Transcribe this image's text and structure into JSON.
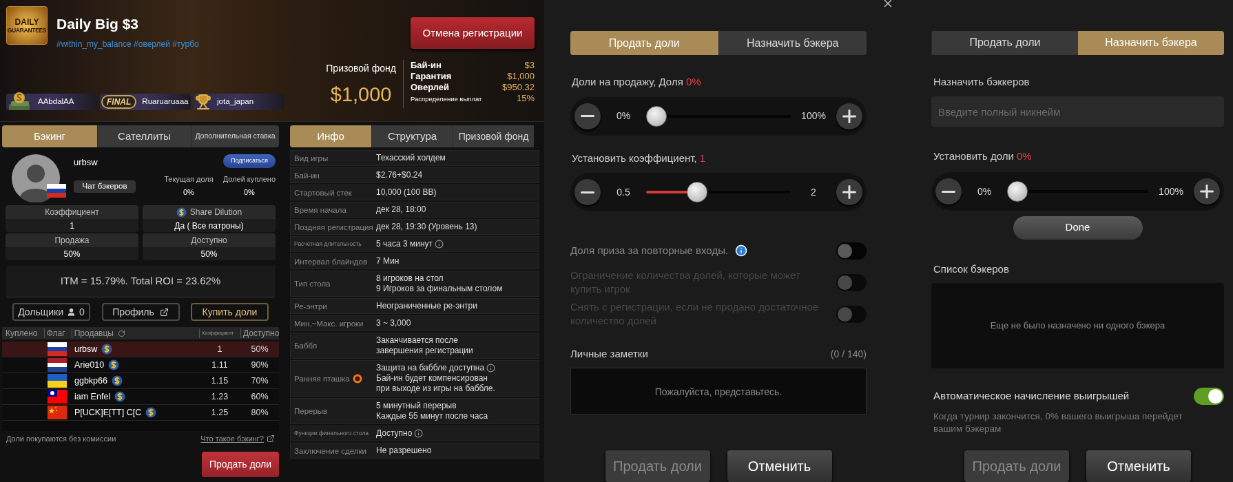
{
  "tournament": {
    "logo_text": [
      "DAILY",
      "GUARANTEES"
    ],
    "title": "Daily Big $3",
    "tags": "#within_my_balance #оверлей #турбо",
    "cancel_button": "Отмена регистрации",
    "prize_label": "Призовой фонд",
    "prize_amount": "$1,000",
    "details": [
      {
        "label": "Бай-ин",
        "value": "$3",
        "kind": "main"
      },
      {
        "label": "Гарантия",
        "value": "$1,000",
        "kind": "main"
      },
      {
        "label": "Оверлей",
        "value": "$950.32",
        "kind": "main"
      },
      {
        "label": "Распределение выплат",
        "value": "15%",
        "kind": "minor"
      }
    ],
    "winners": [
      {
        "kind": "cash",
        "name": "AAbdalAA"
      },
      {
        "kind": "final",
        "badge": "FINAL",
        "name": "Ruaruaruaaa"
      },
      {
        "kind": "trophy",
        "name": "jota_japan"
      }
    ]
  },
  "backing": {
    "tabs": [
      {
        "label": "Бэкинг",
        "selected": true
      },
      {
        "label": "Сателлиты",
        "selected": false
      },
      {
        "label": "Дополнительная ставка",
        "selected": false
      }
    ],
    "player": {
      "name": "urbsw",
      "flag": {
        "kind": "ru"
      },
      "subscribe": "Подписаться",
      "chat": "Чат бэкеров",
      "stats": [
        {
          "label": "Текущая доля",
          "value": "0%"
        },
        {
          "label": "Долей куплено",
          "value": "0%"
        }
      ]
    },
    "terms": [
      {
        "label": "Коэффициент",
        "value": "1",
        "icon": false
      },
      {
        "label": "Share Dilution",
        "value": "Да ( Все патроны)",
        "icon": true
      },
      {
        "label": "Продажа",
        "value": "50%",
        "icon": false
      },
      {
        "label": "Доступно",
        "value": "50%",
        "icon": false
      }
    ],
    "roi": "ITM = 15.79%. Total ROI = 23.62%",
    "actions": [
      {
        "kind": "holders",
        "label": "Дольщики",
        "count": "0"
      },
      {
        "kind": "profile",
        "label": "Профиль"
      },
      {
        "kind": "buy",
        "label": "Купить доли"
      }
    ],
    "columns": [
      {
        "label": "Куплено",
        "kind": "plain"
      },
      {
        "label": "Флаг",
        "kind": "plain"
      },
      {
        "label": "Продавцы",
        "kind": "refresh"
      },
      {
        "label": "Коэффициент",
        "kind": "compact"
      },
      {
        "label": "Доступно",
        "kind": "plain"
      }
    ],
    "rows": [
      {
        "flag": {
          "kind": "ru"
        },
        "seller": "urbsw",
        "rate": "1",
        "available": "50%",
        "selected": true
      },
      {
        "flag": {
          "kind": "nl"
        },
        "seller": "Arie010",
        "rate": "1.11",
        "available": "90%",
        "selected": false
      },
      {
        "flag": {
          "kind": "ua"
        },
        "seller": "ggbkp66",
        "rate": "1.15",
        "available": "70%",
        "selected": false
      },
      {
        "flag": {
          "kind": "tw"
        },
        "seller": "iam Enfel",
        "rate": "1.23",
        "available": "60%",
        "selected": false
      },
      {
        "flag": {
          "kind": "cn"
        },
        "seller": "P[UCK]E[TT] C[C",
        "rate": "1.25",
        "available": "80%",
        "selected": false
      }
    ],
    "footer_note": "Доли покупаются без комиссии",
    "help_link": "Что такое бэкинг?",
    "sell_button": "Продать доли"
  },
  "info": {
    "tabs": [
      {
        "label": "Инфо",
        "selected": true
      },
      {
        "label": "Структура",
        "selected": false
      },
      {
        "label": "Призовой фонд",
        "selected": false
      }
    ],
    "rows": [
      {
        "label": "Вид игры",
        "kind": "normal",
        "label_icon": false,
        "lines": [
          {
            "text": "Техасский холдем",
            "info": false
          }
        ]
      },
      {
        "label": "Бай-ин",
        "kind": "normal",
        "label_icon": false,
        "lines": [
          {
            "text": "$2.76+$0.24",
            "info": false
          }
        ]
      },
      {
        "label": "Стартовый стек",
        "kind": "normal",
        "label_icon": false,
        "lines": [
          {
            "text": "10,000 (100 BB)",
            "info": false
          }
        ]
      },
      {
        "label": "Время начала",
        "kind": "normal",
        "label_icon": false,
        "lines": [
          {
            "text": "дек 28, 18:00",
            "info": false
          }
        ]
      },
      {
        "label": "Поздняя регистрация",
        "kind": "normal",
        "label_icon": false,
        "lines": [
          {
            "text": "дек 28, 19:30 (Уровень 13)",
            "info": false
          }
        ]
      },
      {
        "label": "Расчетная длительность",
        "kind": "compact",
        "label_icon": false,
        "lines": [
          {
            "text": "5 часа 3 минут",
            "info": true
          }
        ]
      },
      {
        "label": "Интервал блайндов",
        "kind": "normal",
        "label_icon": false,
        "lines": [
          {
            "text": "7 Мин",
            "info": false
          }
        ]
      },
      {
        "label": "Тип стола",
        "kind": "normal",
        "label_icon": false,
        "lines": [
          {
            "text": "8 игроков на стол",
            "info": false
          },
          {
            "text": "9 Игроков за финальным столом",
            "info": false
          }
        ]
      },
      {
        "label": "Ре-энтри",
        "kind": "normal",
        "label_icon": false,
        "lines": [
          {
            "text": "Неограниченные ре-энтри",
            "info": false
          }
        ]
      },
      {
        "label": "Мин.~Макс. игроки",
        "kind": "normal",
        "label_icon": false,
        "lines": [
          {
            "text": "3 ~ 3,000",
            "info": false
          }
        ]
      },
      {
        "label": "Баббл",
        "kind": "normal",
        "label_icon": false,
        "lines": [
          {
            "text": "Заканчивается после",
            "info": false
          },
          {
            "text": "завершения регистрации",
            "info": false
          }
        ]
      },
      {
        "label": "Ранняя пташка",
        "kind": "normal",
        "label_icon": true,
        "lines": [
          {
            "text": "Защита на баббле доступна",
            "info": true
          },
          {
            "text": "Бай-ин будет компенсирован",
            "info": false
          },
          {
            "text": "при выходе из игры на баббле.",
            "info": false
          }
        ]
      },
      {
        "label": "Перерыв",
        "kind": "normal",
        "label_icon": false,
        "lines": [
          {
            "text": "5 минутный перерыв",
            "info": false
          },
          {
            "text": "Каждые 55 минут после часа",
            "info": false
          }
        ]
      },
      {
        "label": "Функции финального стола",
        "kind": "compact",
        "label_icon": false,
        "lines": [
          {
            "text": "Доступно",
            "info": true
          }
        ]
      },
      {
        "label": "Заключение сделки",
        "kind": "normal",
        "label_icon": false,
        "lines": [
          {
            "text": "Не разрешено",
            "info": false
          }
        ]
      }
    ]
  },
  "sell_panel": {
    "tabs": [
      {
        "label": "Продать доли",
        "selected": true
      },
      {
        "label": "Назначить бэкера",
        "selected": false
      }
    ],
    "sliders": [
      {
        "label": "Доли на продажу, Доля",
        "value": "0%",
        "min": "0%",
        "max": "100%",
        "level": 0
      },
      {
        "label": "Установить коэффициент,",
        "value": "1",
        "min": "0.5",
        "max": "2",
        "level": 0.33
      }
    ],
    "options": [
      {
        "label": "Доля приза за повторные входы.",
        "info": true,
        "on": false,
        "disabled": false
      },
      {
        "label": "Ограничение количества долей, которые может купить игрок",
        "info": false,
        "on": false,
        "disabled": true
      },
      {
        "label": "Снять с регистрации, если не продано достаточное количество долей",
        "info": false,
        "on": false,
        "disabled": true
      }
    ],
    "notes": {
      "label": "Личные заметки",
      "counter": "(0 / 140)",
      "placeholder": "Пожалуйста, представьтесь."
    },
    "buttons": [
      {
        "label": "Продать доли",
        "disabled": true
      },
      {
        "label": "Отменить",
        "disabled": false
      }
    ]
  },
  "backer_panel": {
    "tabs": [
      {
        "label": "Продать доли",
        "selected": false
      },
      {
        "label": "Назначить бэкера",
        "selected": true
      }
    ],
    "assign_label": "Назначить бэккеров",
    "nickname_placeholder": "Введите полный никнейм",
    "slider": {
      "label": "Установить доли",
      "value": "0%",
      "min": "0%",
      "max": "100%",
      "level": 0
    },
    "done": "Done",
    "list_label": "Список бэкеров",
    "empty": "Еще не было назначено ни одного бэкера",
    "auto": {
      "label": "Автоматическое начисление выигрышей",
      "on": true,
      "description": "Когда турнир закончится, 0% вашего выигрыша перейдет вашим бэкерам"
    },
    "buttons": [
      {
        "label": "Продать доли",
        "disabled": true
      },
      {
        "label": "Отменить",
        "disabled": false
      }
    ]
  }
}
